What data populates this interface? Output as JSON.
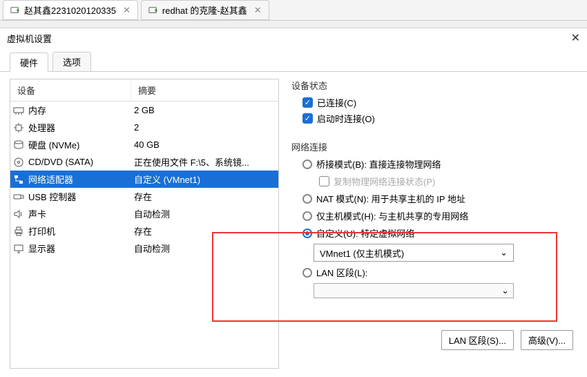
{
  "topTabs": [
    {
      "label": "赵其鑫2231020120335",
      "active": true
    },
    {
      "label": "redhat 的克隆-赵其鑫",
      "active": false
    }
  ],
  "dialog": {
    "title": "虚拟机设置",
    "close": "✕"
  },
  "innerTabs": {
    "hardware": "硬件",
    "options": "选项"
  },
  "columns": {
    "device": "设备",
    "summary": "摘要"
  },
  "hardware": [
    {
      "icon": "memory",
      "name": "内存",
      "summary": "2 GB"
    },
    {
      "icon": "cpu",
      "name": "处理器",
      "summary": "2"
    },
    {
      "icon": "disk",
      "name": "硬盘 (NVMe)",
      "summary": "40 GB"
    },
    {
      "icon": "cd",
      "name": "CD/DVD (SATA)",
      "summary": "正在使用文件 F:\\5、系统镜..."
    },
    {
      "icon": "net",
      "name": "网络适配器",
      "summary": "自定义 (VMnet1)",
      "selected": true
    },
    {
      "icon": "usb",
      "name": "USB 控制器",
      "summary": "存在"
    },
    {
      "icon": "sound",
      "name": "声卡",
      "summary": "自动检测"
    },
    {
      "icon": "printer",
      "name": "打印机",
      "summary": "存在"
    },
    {
      "icon": "display",
      "name": "显示器",
      "summary": "自动检测"
    }
  ],
  "status": {
    "label": "设备状态",
    "connected": "已连接(C)",
    "connectAtPower": "启动时连接(O)"
  },
  "network": {
    "label": "网络连接",
    "bridged": "桥接模式(B): 直接连接物理网络",
    "replicate": "复制物理网络连接状态(P)",
    "nat": "NAT 模式(N): 用于共享主机的 IP 地址",
    "hostOnly": "仅主机模式(H): 与主机共享的专用网络",
    "custom": "自定义(U): 特定虚拟网络",
    "customSelected": "VMnet1 (仅主机模式)",
    "lan": "LAN 区段(L):"
  },
  "buttons": {
    "lanSegments": "LAN 区段(S)...",
    "advanced": "高级(V)..."
  }
}
